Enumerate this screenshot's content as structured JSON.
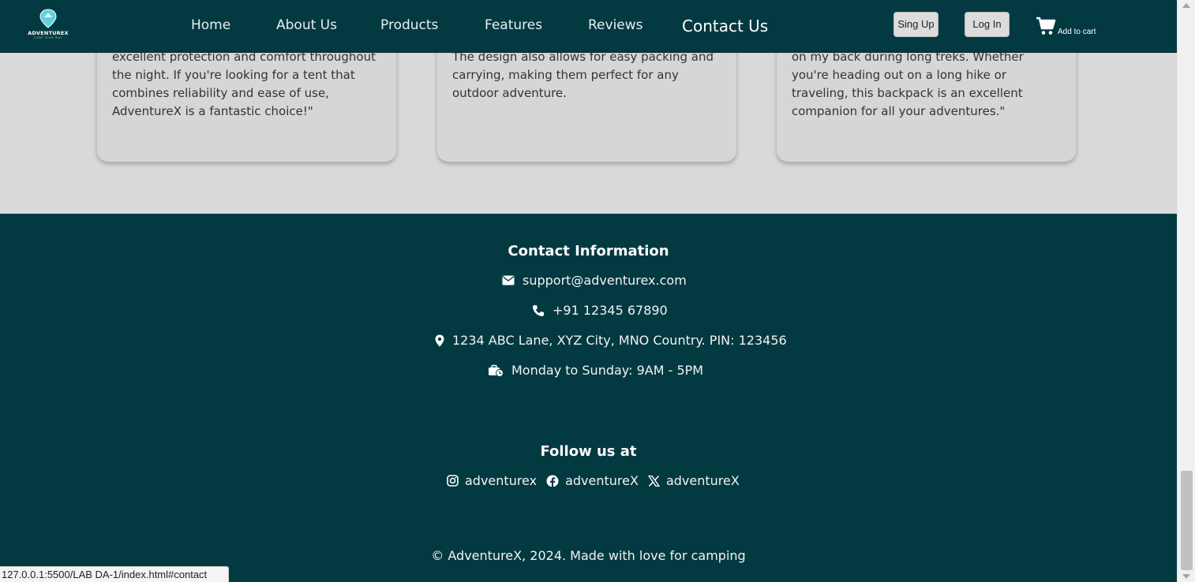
{
  "header": {
    "logo_text": "ADVENTUREX",
    "logo_subtext": "CAMP YOUR WAY",
    "nav": [
      {
        "label": "Home"
      },
      {
        "label": "About Us"
      },
      {
        "label": "Products"
      },
      {
        "label": "Features"
      },
      {
        "label": "Reviews"
      },
      {
        "label": "Contact Us",
        "active": true
      }
    ],
    "signup_label": "Sing Up",
    "login_label": "Log In",
    "cart_label": "Add to cart",
    "cart_icon": "shopping-cart-icon"
  },
  "reviews": [
    {
      "text": "perfectly. He faults at all. It provided excellent protection and comfort throughout the night. If you're looking for a tent that combines reliability and ease of use, AdventureX is a fantastic choice!\""
    },
    {
      "text": "throughout the night without any discomfort. The design also allows for easy packing and carrying, making them perfect for any outdoor adventure."
    },
    {
      "text": "ergonomic design significantly reduces strain on my back during long treks. Whether you're heading out on a long hike or traveling, this backpack is an excellent companion for all your adventures.\""
    }
  ],
  "footer": {
    "contact_title": "Contact Information",
    "email": "support@adventurex.com",
    "phone": "+91 12345 67890",
    "address": "1234 ABC Lane, XYZ City, MNO Country. PIN: 123456",
    "hours": "Monday to Sunday: 9AM - 5PM",
    "follow_title": "Follow us at",
    "socials": [
      {
        "icon": "instagram-icon",
        "handle": "adventurex"
      },
      {
        "icon": "facebook-icon",
        "handle": "adventureX"
      },
      {
        "icon": "x-twitter-icon",
        "handle": "adventureX"
      }
    ],
    "copyright": "© AdventureX, 2024. Made with love for camping"
  },
  "status_url": "127.0.0.1:5500/LAB DA-1/index.html#contact",
  "colors": {
    "header_bg": "#033a42",
    "footer_bg": "#033a42",
    "page_bg": "#d9d9d9",
    "logo_accent": "#5fd3e0"
  }
}
